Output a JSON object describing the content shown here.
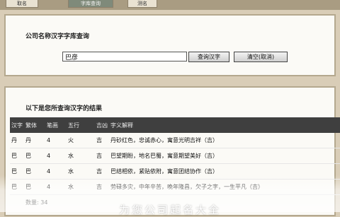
{
  "tabs": [
    {
      "label": "取名"
    },
    {
      "label": "字库查询"
    },
    {
      "label": "测名"
    }
  ],
  "query_panel": {
    "title": "公司名称汉字字库查询",
    "input_value": "巴彦",
    "query_button": "查询汉字",
    "clear_button": "清空(取消)"
  },
  "results_panel": {
    "title": "以下是您所查询汉字的结果",
    "columns": [
      "汉字",
      "繁体",
      "笔画",
      "五行",
      "吉凶",
      "字义解释"
    ],
    "rows": [
      {
        "char": "丹",
        "trad": "丹",
        "stroke": "4",
        "elem": "火",
        "luck": "吉",
        "desc": "丹砂红色，忠诚赤心，寓意光明吉祥（吉）"
      },
      {
        "char": "巴",
        "trad": "巴",
        "stroke": "4",
        "elem": "水",
        "luck": "吉",
        "desc": "巴望期盼，地名巴蜀，寓意期望美好（吉）"
      },
      {
        "char": "巴",
        "trad": "巴",
        "stroke": "4",
        "elem": "水",
        "luck": "吉",
        "desc": "巴结相依，紧贴依附，寓意团结协作（吉）"
      },
      {
        "char": "巴",
        "trad": "巴",
        "stroke": "4",
        "elem": "水",
        "luck": "吉",
        "desc": "劳碌多灾，中年辛苦，晚年隆昌，欠子之字，一生平凡（吉）"
      }
    ],
    "count_label": "数量:",
    "count_value": "34"
  },
  "caption": "为您公司起名大全"
}
